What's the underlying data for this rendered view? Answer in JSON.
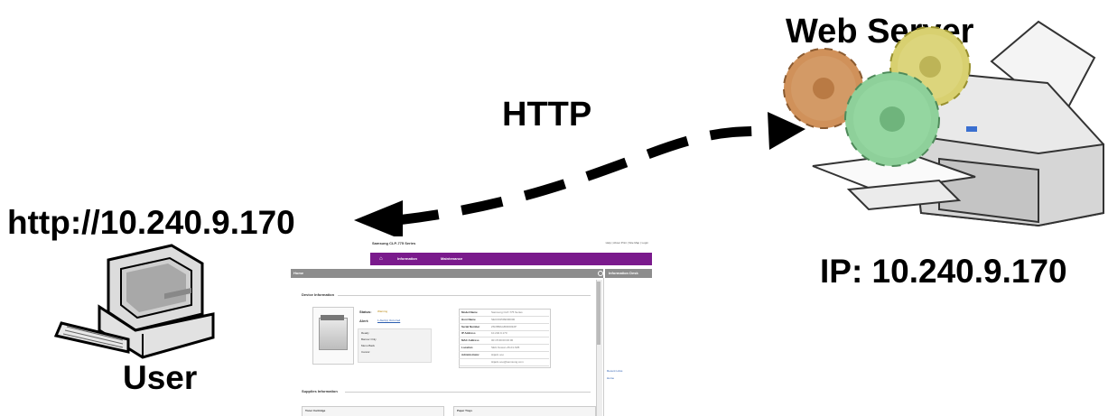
{
  "labels": {
    "url": "http://10.240.9.170",
    "user": "User",
    "protocol": "HTTP",
    "server": "Web Server",
    "ip": "IP: 10.240.9.170"
  },
  "web_page": {
    "title": "Samsung CLP-775 Series",
    "top_links": "Help  |  About Print  |  Site Map  |  Login",
    "nav": {
      "information": "Information",
      "maintenance": "Maintenance"
    },
    "home_tab": "Home",
    "info_desk": "Information Desk",
    "device_header": "Device Information",
    "status_label": "Status:",
    "status_value": "Warning",
    "alert_label": "Alert:",
    "alert_value": "1 Alert(s) Occurred",
    "sub_lines": [
      "Ready",
      "Banner Only",
      "Menu  Back",
      "Cancel"
    ],
    "device_table": [
      {
        "k": "Model Name",
        "v": "Samsung CLP-775 Series"
      },
      {
        "k": "Host Name",
        "v": "SEC001599000000"
      },
      {
        "k": "Serial Number",
        "v": "Z6CBBAGB300032P"
      },
      {
        "k": "IP Address",
        "v": "10.240.9.170"
      },
      {
        "k": "MAC Address",
        "v": "00:15:99:00:00:00"
      },
      {
        "k": "Location",
        "v": "SEC-Suwon-26-01-S05"
      },
      {
        "k": "Administrator",
        "v": "Hijack ooo"
      },
      {
        "k": "",
        "v": "Hijack.ooo@samsung.com"
      }
    ],
    "supplies_header": "Supplies Information",
    "toner_label": "Toner Cartridge",
    "tray_label": "Paper Trays",
    "side_links": [
      "Recent Links",
      "Home"
    ]
  },
  "colors": {
    "nav_purple": "#7a1a8c",
    "arrow": "#000000",
    "gear_orange": "#d0915a",
    "gear_yellow": "#d8d070",
    "gear_green": "#8ed09a"
  }
}
